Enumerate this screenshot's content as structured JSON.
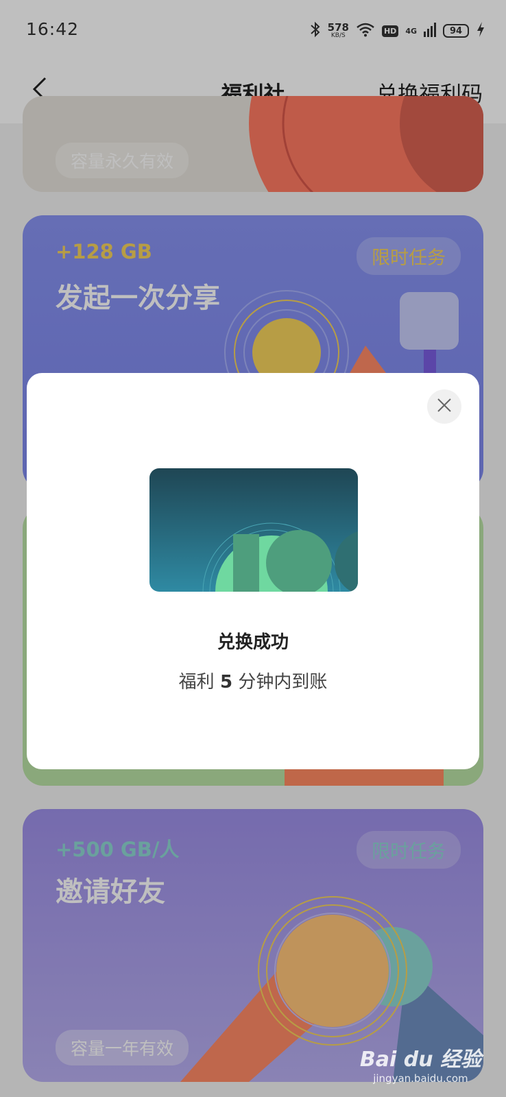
{
  "status_bar": {
    "time": "16:42",
    "net_speed_value": "578",
    "net_speed_unit": "KB/S",
    "hd_label": "HD",
    "network_label": "4G",
    "battery_level": "94",
    "icons": [
      "bluetooth-icon",
      "wifi-icon",
      "signal-icon",
      "battery-icon",
      "charging-icon"
    ]
  },
  "nav": {
    "title": "福利社",
    "action": "兑换福利码"
  },
  "cards": [
    {
      "validity": "容量永久有效"
    },
    {
      "reward": "+128 GB",
      "title": "发起一次分享",
      "tag": "限时任务",
      "accent": "#f4d25c"
    },
    {
      "reward": "+500 GB/人",
      "title": "邀请好友",
      "tag": "限时任务",
      "validity": "容量一年有效",
      "accent": "#8ed7d2"
    }
  ],
  "dialog": {
    "title": "兑换成功",
    "desc_prefix": "福利",
    "desc_number": "5",
    "desc_suffix": "分钟内到账",
    "close_icon": "close-icon"
  },
  "watermark": {
    "logo": "Bai du 经验",
    "url": "jingyan.baidu.com"
  },
  "colors": {
    "overlay": "rgba(0,0,0,0.25)",
    "share_card": "#8893f2",
    "invite_card": "#9d8fe8",
    "green_card": "#b9e0a4"
  }
}
